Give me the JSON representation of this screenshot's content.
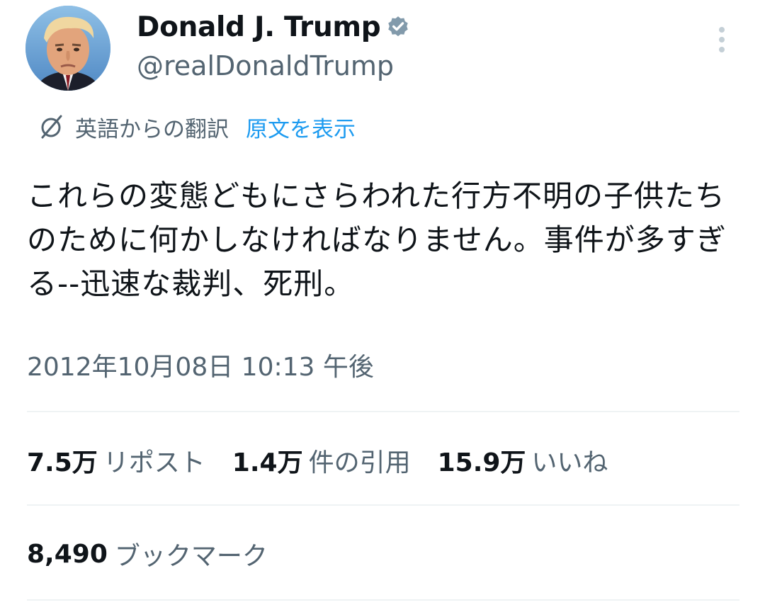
{
  "author": {
    "display_name": "Donald J. Trump",
    "handle": "@realDonaldTrump",
    "verified": true
  },
  "icons": {
    "verified": "verified-badge-icon",
    "more": "more-vertical-icon",
    "translate": "translate-icon"
  },
  "translation": {
    "label": "英語からの翻訳",
    "show_original": "原文を表示"
  },
  "tweet": {
    "text": "これらの変態どもにさらわれた行方不明の子供たちのために何かしなければなりません。事件が多すぎる--迅速な裁判、死刑。",
    "timestamp": "2012年10月08日 10:13 午後"
  },
  "stats": {
    "reposts": {
      "value": "7.5万",
      "label": "リポスト"
    },
    "quotes": {
      "value": "1.4万",
      "label": "件の引用"
    },
    "likes": {
      "value": "15.9万",
      "label": "いいね"
    },
    "bookmarks": {
      "value": "8,490",
      "label": "ブックマーク"
    }
  },
  "colors": {
    "text_primary": "#0f1419",
    "text_secondary": "#536471",
    "link": "#1d9bf0",
    "verified": "#829aab",
    "divider": "#eff3f4"
  }
}
